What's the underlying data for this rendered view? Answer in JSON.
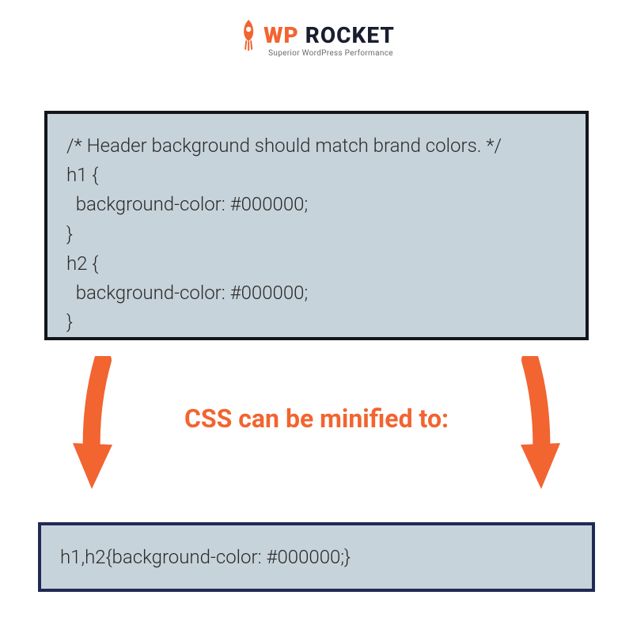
{
  "logo": {
    "brand_wp": "WP",
    "brand_rest": " ROCKET",
    "tagline": "Superior WordPress Performance"
  },
  "code_before": {
    "line1": "/* Header background should match brand colors. */",
    "line2": "h1 {",
    "line3": "  background-color: #000000;",
    "line4": "}",
    "line5": "h2 {",
    "line6": "  background-color: #000000;",
    "line7": "}"
  },
  "caption": "CSS can be minified to:",
  "code_after": "h1,h2{background-color: #000000;}",
  "colors": {
    "accent": "#f26430",
    "box_bg": "#c7d3da",
    "border_top": "#12161a",
    "border_bottom": "#1f2a56"
  }
}
